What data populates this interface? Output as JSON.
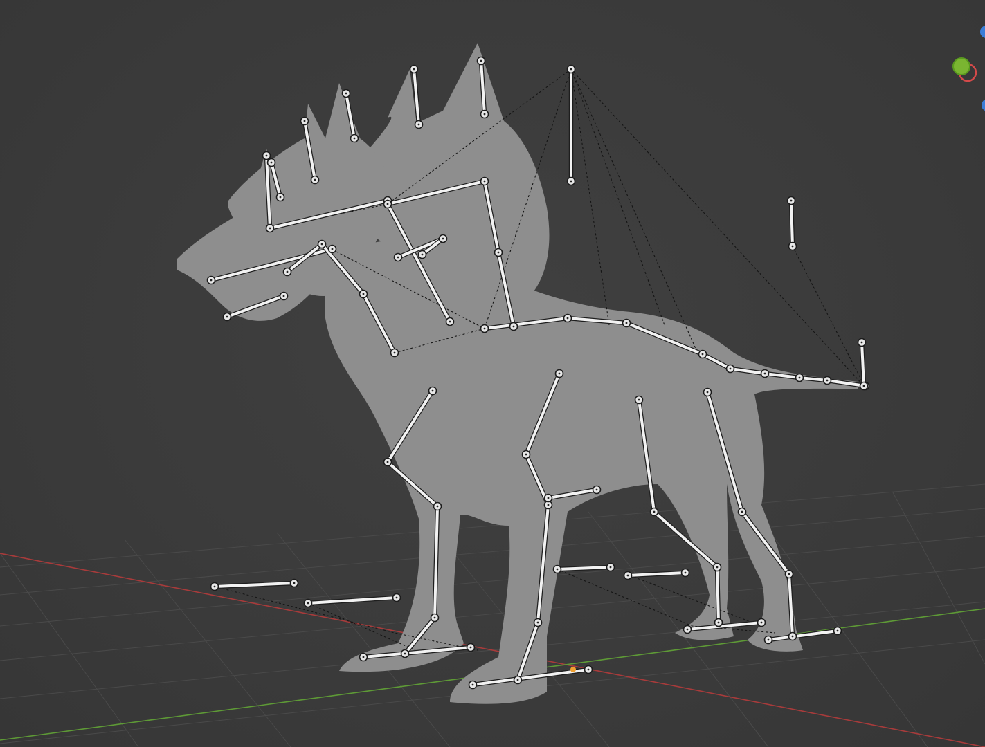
{
  "viewport": {
    "object": "cerberus-mesh",
    "armature": "cerberus-armature",
    "mode": "pose",
    "colors": {
      "background": "#3a3a3a",
      "mesh": "#8e8e8e",
      "bone": "#f2f2f2",
      "x_axis": "#a83b3b",
      "y_axis": "#5e9a36",
      "active_joint": "#f0a030"
    }
  },
  "navigation_gizmo": {
    "axes": [
      "z-axis",
      "y-axis",
      "x-axis",
      "neg-z-axis"
    ],
    "colors": [
      "#3b7dd8",
      "#7ab531",
      "#d44a4a",
      "#3b7dd8"
    ]
  }
}
